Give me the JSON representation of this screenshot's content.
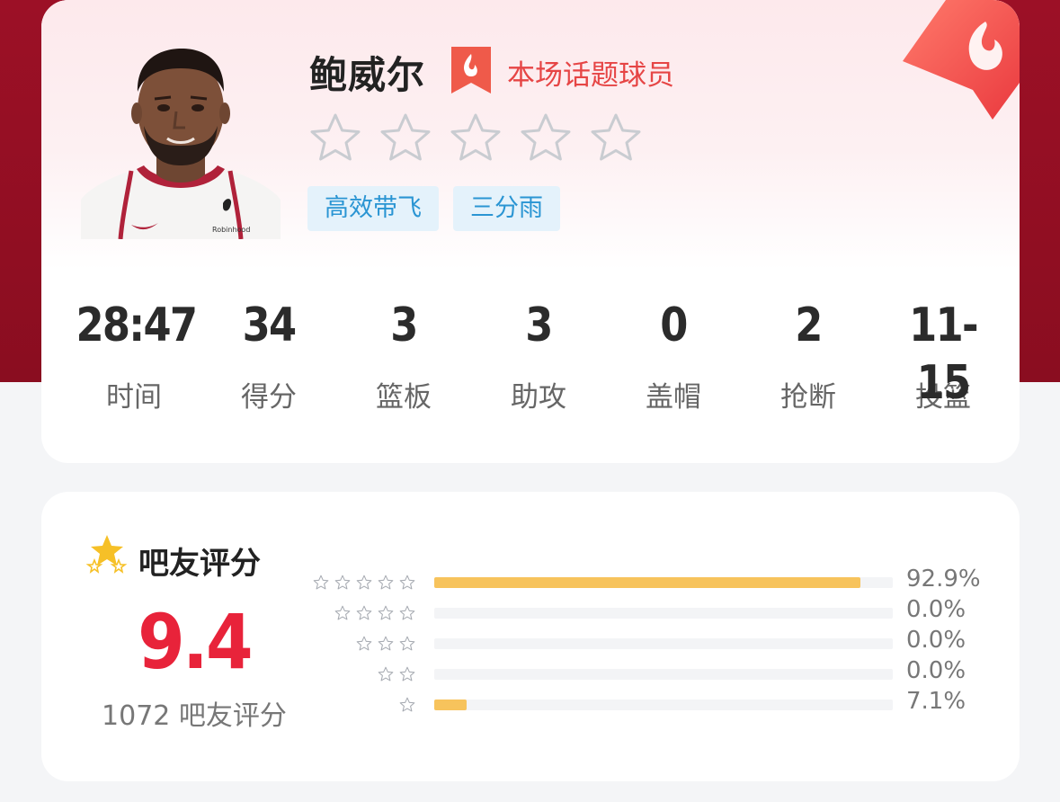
{
  "player": {
    "name": "鲍威尔",
    "badge_label": "本场话题球员",
    "star_rating": 0,
    "star_max": 5,
    "tags": [
      "高效带飞",
      "三分雨"
    ],
    "jersey_text": "Robinhood"
  },
  "stats": [
    {
      "value": "28:47",
      "label": "时间"
    },
    {
      "value": "34",
      "label": "得分"
    },
    {
      "value": "3",
      "label": "篮板"
    },
    {
      "value": "3",
      "label": "助攻"
    },
    {
      "value": "0",
      "label": "盖帽"
    },
    {
      "value": "2",
      "label": "抢断"
    },
    {
      "value": "11-15",
      "label": "投篮"
    }
  ],
  "rating": {
    "title": "吧友评分",
    "score": "9.4",
    "count_text": "1072 吧友评分",
    "distribution": [
      {
        "stars": 5,
        "percent_text": "92.9%",
        "fraction": 0.929
      },
      {
        "stars": 4,
        "percent_text": "0.0%",
        "fraction": 0.0
      },
      {
        "stars": 3,
        "percent_text": "0.0%",
        "fraction": 0.0
      },
      {
        "stars": 2,
        "percent_text": "0.0%",
        "fraction": 0.0
      },
      {
        "stars": 1,
        "percent_text": "7.1%",
        "fraction": 0.071
      }
    ]
  },
  "colors": {
    "header_bg": "#9c1026",
    "accent_red": "#e8233a",
    "badge_red": "#e64545",
    "tag_bg": "#e4f2fb",
    "tag_text": "#2a95d3",
    "bar_fill": "#f7c35c"
  },
  "icons": {
    "badge": "flame-ribbon-icon",
    "corner": "flame-flag-icon",
    "rating": "gold-stars-icon"
  }
}
